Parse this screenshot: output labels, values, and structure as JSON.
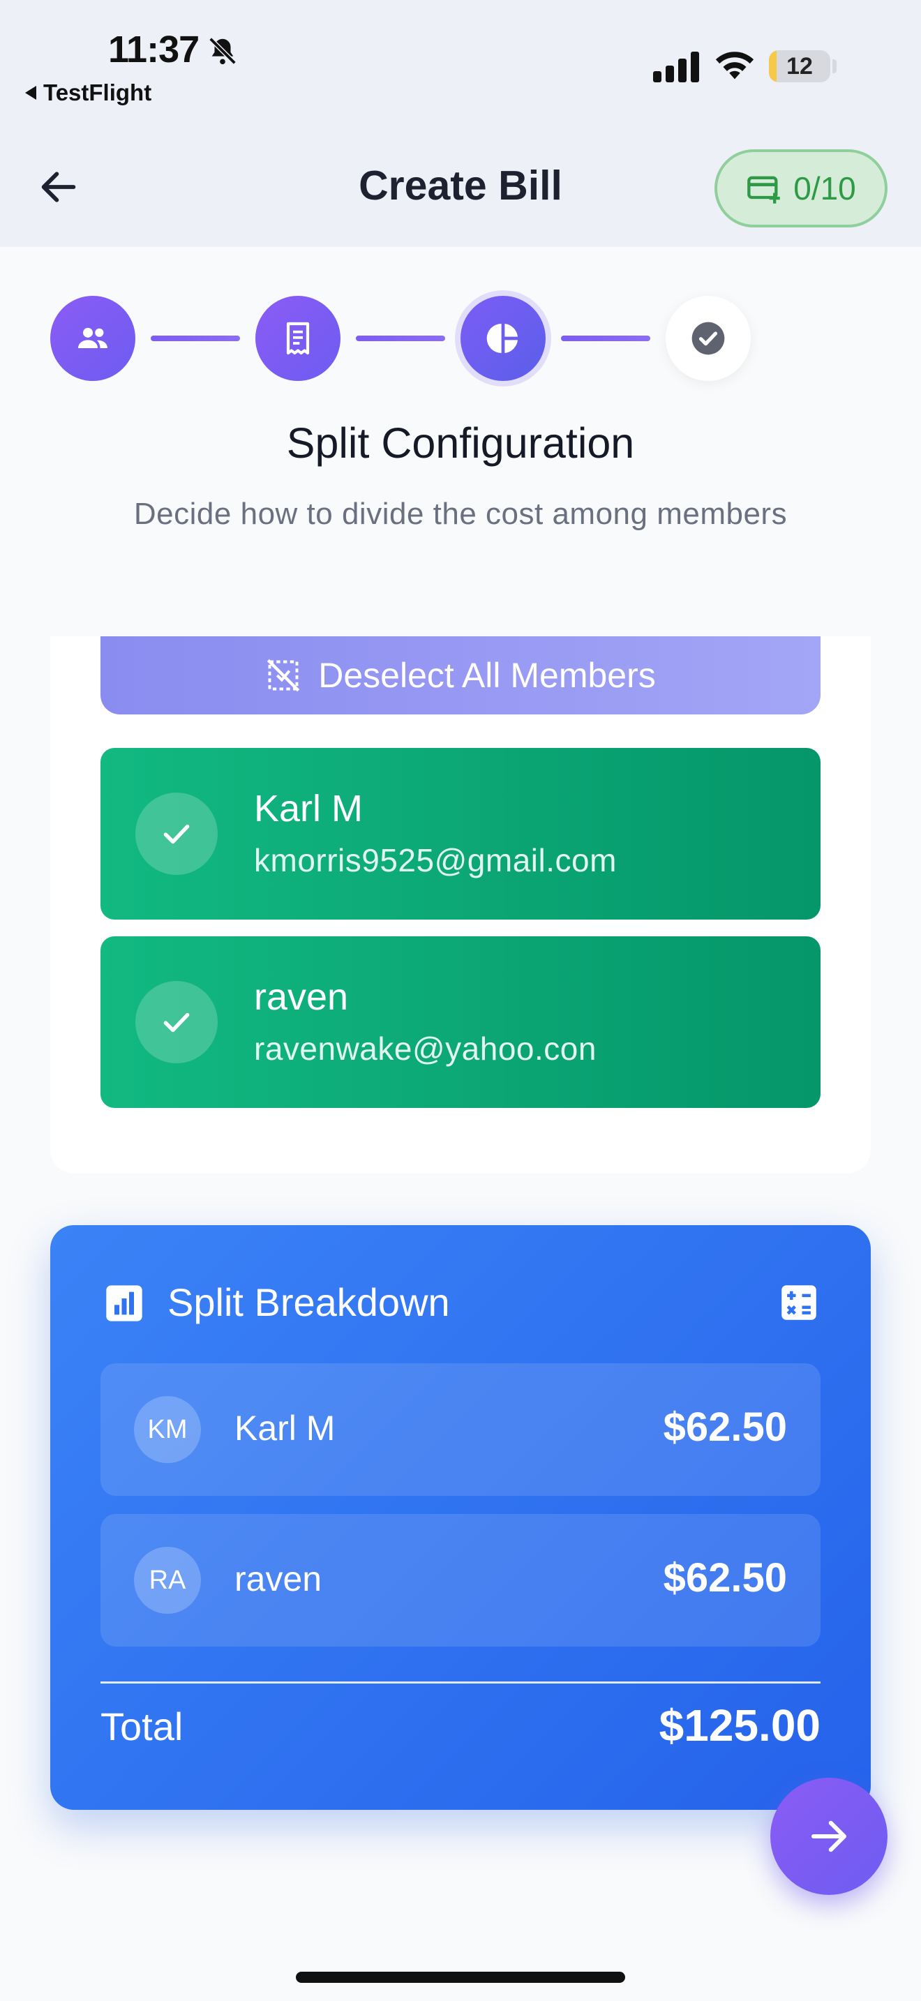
{
  "status_bar": {
    "time": "11:37",
    "back_app": "TestFlight",
    "battery_level": "12",
    "battery_fraction": 0.12
  },
  "header": {
    "title": "Create Bill",
    "bill_counter": "0/10"
  },
  "stepper": {
    "steps": [
      {
        "icon": "group-icon",
        "state": "done"
      },
      {
        "icon": "receipt-icon",
        "state": "done"
      },
      {
        "icon": "pie-chart-icon",
        "state": "active"
      },
      {
        "icon": "check-circle-icon",
        "state": "todo"
      }
    ]
  },
  "section": {
    "title": "Split Configuration",
    "subtitle": "Decide how to divide the cost among members"
  },
  "members": {
    "deselect_label": "Deselect All Members",
    "items": [
      {
        "name": "Karl M",
        "email": "kmorris9525@gmail.com",
        "selected": true
      },
      {
        "name": "raven",
        "email": "ravenwake@yahoo.con",
        "selected": true
      }
    ]
  },
  "breakdown": {
    "title": "Split Breakdown",
    "rows": [
      {
        "initials": "KM",
        "name": "Karl M",
        "amount": "$62.50"
      },
      {
        "initials": "RA",
        "name": "raven",
        "amount": "$62.50"
      }
    ],
    "total_label": "Total",
    "total_value": "$125.00"
  },
  "colors": {
    "accent_purple": "#7c5cf5",
    "member_green": "#10b981",
    "breakdown_blue": "#2f73f0",
    "counter_green": "#2e9a45"
  }
}
